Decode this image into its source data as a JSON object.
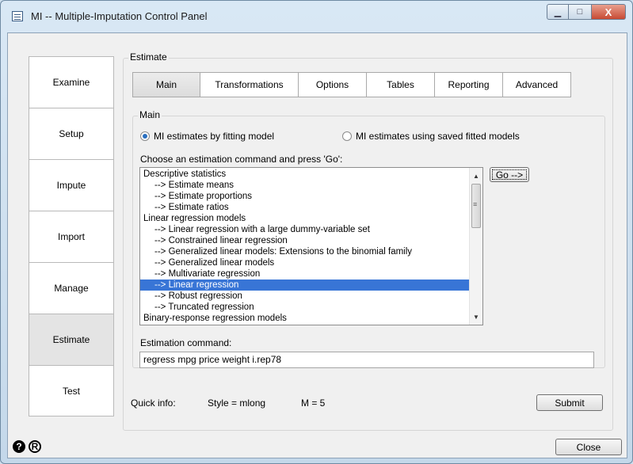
{
  "window": {
    "title": "MI -- Multiple-Imputation Control Panel",
    "minimize_glyph": "▁",
    "maximize_glyph": "□",
    "close_glyph": "X"
  },
  "nav": {
    "items": [
      {
        "label": "Examine"
      },
      {
        "label": "Setup"
      },
      {
        "label": "Impute"
      },
      {
        "label": "Import"
      },
      {
        "label": "Manage"
      },
      {
        "label": "Estimate",
        "active": true
      },
      {
        "label": "Test"
      }
    ]
  },
  "estimate": {
    "group_label": "Estimate",
    "tabs": [
      {
        "label": "Main",
        "active": true
      },
      {
        "label": "Transformations"
      },
      {
        "label": "Options"
      },
      {
        "label": "Tables"
      },
      {
        "label": "Reporting"
      },
      {
        "label": "Advanced"
      }
    ],
    "main_group_label": "Main",
    "radio_fit": {
      "label": "MI estimates by fitting model",
      "selected": true
    },
    "radio_saved": {
      "label": "MI estimates using saved fitted models",
      "selected": false
    },
    "choose_label": "Choose an estimation command and press 'Go':",
    "list": [
      {
        "text": "Descriptive statistics",
        "sub": false
      },
      {
        "text": "--> Estimate means",
        "sub": true
      },
      {
        "text": "--> Estimate proportions",
        "sub": true
      },
      {
        "text": "--> Estimate ratios",
        "sub": true
      },
      {
        "text": "Linear regression models",
        "sub": false
      },
      {
        "text": "--> Linear regression with a large dummy-variable set",
        "sub": true
      },
      {
        "text": "--> Constrained linear regression",
        "sub": true
      },
      {
        "text": "--> Generalized linear models: Extensions to the binomial family",
        "sub": true
      },
      {
        "text": "--> Generalized linear models",
        "sub": true
      },
      {
        "text": "--> Multivariate regression",
        "sub": true
      },
      {
        "text": "--> Linear regression",
        "sub": true,
        "selected": true
      },
      {
        "text": "--> Robust regression",
        "sub": true
      },
      {
        "text": "--> Truncated regression",
        "sub": true
      },
      {
        "text": "Binary-response regression models",
        "sub": false
      }
    ],
    "go_button": "Go -->",
    "command_label": "Estimation command:",
    "command_value": "regress mpg price weight i.rep78",
    "quick_info_label": "Quick info:",
    "style_info": "Style = mlong",
    "m_info": "M = 5",
    "submit_button": "Submit"
  },
  "footer": {
    "help_icon_glyph": "?",
    "report_icon_glyph": "R",
    "close_button": "Close"
  },
  "colors": {
    "selection": "#3875d6",
    "frame": "#c4d8ea",
    "close_button": "#c74a33"
  }
}
